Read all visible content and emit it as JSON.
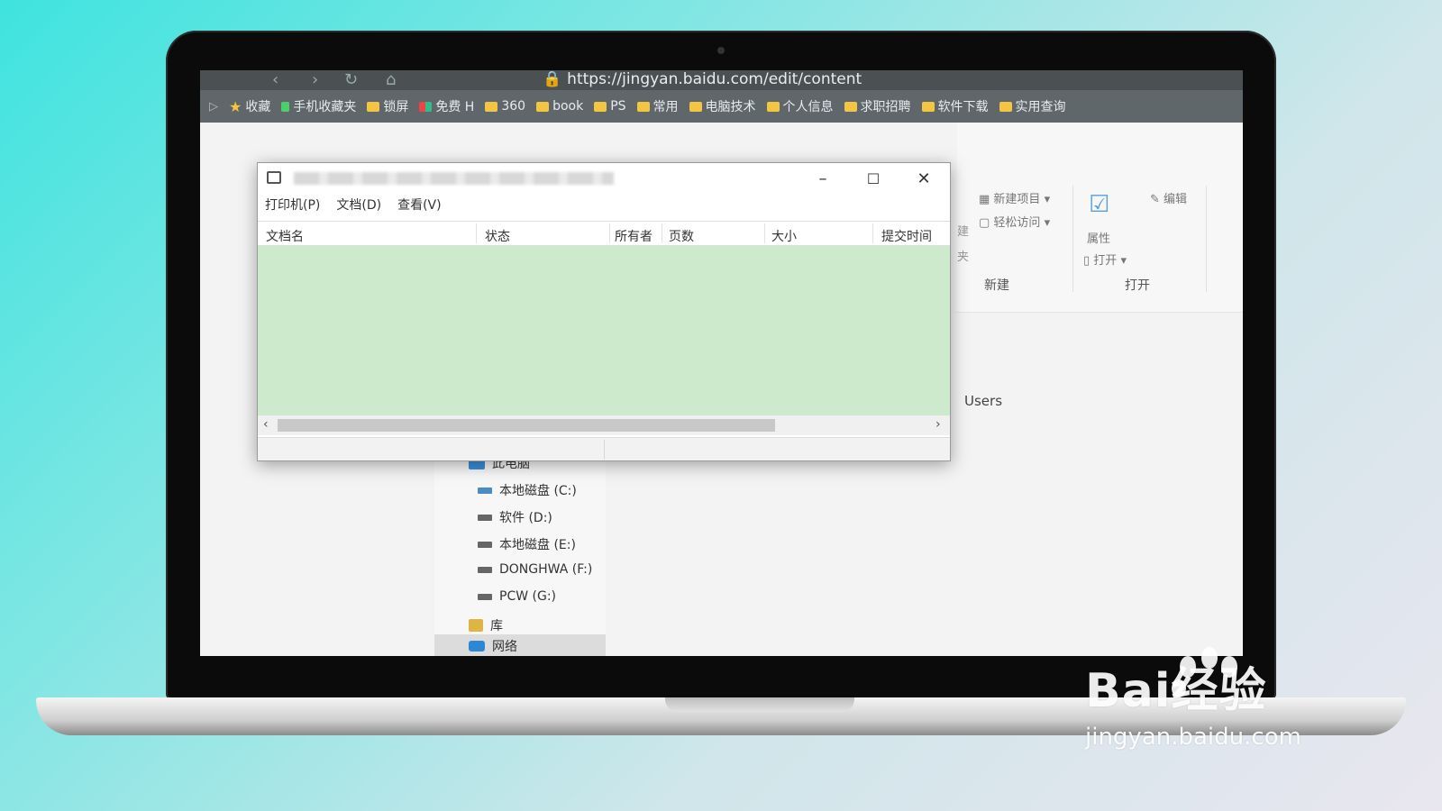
{
  "browser": {
    "url": "https://jingyan.baidu.com/edit/content",
    "bookmarks": [
      {
        "label": "收藏",
        "type": "star"
      },
      {
        "label": "手机收藏夹",
        "type": "page"
      },
      {
        "label": "锁屏",
        "type": "folder"
      },
      {
        "label": "免费 H",
        "type": "folder"
      },
      {
        "label": "360",
        "type": "folder"
      },
      {
        "label": "book",
        "type": "folder"
      },
      {
        "label": "PS",
        "type": "folder"
      },
      {
        "label": "常用",
        "type": "folder"
      },
      {
        "label": "电脑技术",
        "type": "folder"
      },
      {
        "label": "个人信息",
        "type": "folder"
      },
      {
        "label": "求职招聘",
        "type": "folder"
      },
      {
        "label": "软件下载",
        "type": "folder"
      },
      {
        "label": "实用查询",
        "type": "folder"
      }
    ]
  },
  "ribbon": {
    "new_item": "新建项目",
    "easy_access": "轻松访问",
    "properties": "属性",
    "open": "打开",
    "edit": "编辑",
    "group_new": "新建",
    "group_open": "打开",
    "partial_label_1": "建",
    "partial_label_2": "夹"
  },
  "explorer": {
    "users": "Users",
    "tree": {
      "this_pc": "此电脑",
      "drive_c": "本地磁盘 (C:)",
      "drive_d": "软件 (D:)",
      "drive_e": "本地磁盘 (E:)",
      "drive_f": "DONGHWA (F:)",
      "drive_g": "PCW (G:)",
      "library": "库",
      "network": "网络"
    }
  },
  "print_queue": {
    "menu": {
      "printer": "打印机(P)",
      "document": "文档(D)",
      "view": "查看(V)"
    },
    "columns": {
      "doc_name": "文档名",
      "status": "状态",
      "owner": "所有者",
      "pages": "页数",
      "size": "大小",
      "submitted": "提交时间"
    },
    "window_controls": {
      "minimize": "–",
      "maximize": "☐",
      "close": "✕"
    }
  },
  "watermark": {
    "brand": "Bai经验",
    "site": "jingyan.baidu.com"
  },
  "colors": {
    "list_bg": "#cdebcc",
    "background_accent": "#3fe3df"
  }
}
